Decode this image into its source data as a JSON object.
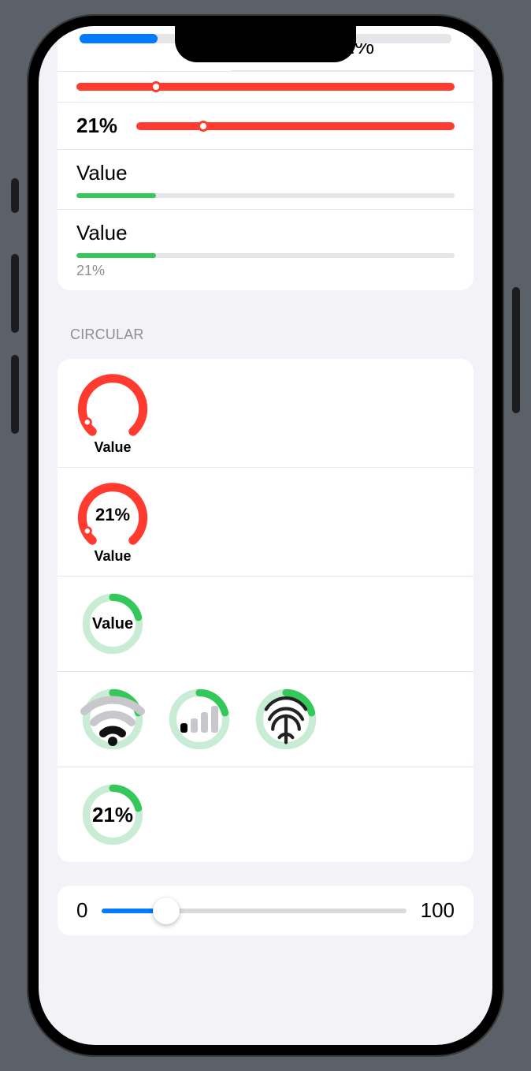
{
  "percent_label": "21%",
  "percent_value": 21,
  "strip_percent": 21,
  "bars": {
    "red_slider_1": {
      "thumb_percent": 21
    },
    "red_slider_2": {
      "label": "21%",
      "thumb_percent": 21
    },
    "value_bar_1": {
      "title": "Value",
      "fill_percent": 21
    },
    "value_bar_2": {
      "title": "Value",
      "fill_percent": 21,
      "caption": "21%"
    }
  },
  "section_circular_header": "CIRCULAR",
  "circular": {
    "gauge_red_1": {
      "percent": 5,
      "label": "Value",
      "color": "#ff3b30"
    },
    "gauge_red_2": {
      "percent": 5,
      "center": "21%",
      "label": "Value",
      "color": "#ff3b30"
    },
    "ring_green_value": {
      "percent": 21,
      "center": "Value",
      "color": "#34c759",
      "track": "#c8ecd4"
    },
    "ring_icons": [
      {
        "name": "wifi",
        "percent": 21
      },
      {
        "name": "cell",
        "percent": 21
      },
      {
        "name": "touchid",
        "percent": 21
      }
    ],
    "ring_green_percent": {
      "percent": 21,
      "center": "21%",
      "color": "#34c759",
      "track": "#c8ecd4"
    }
  },
  "bottom_slider": {
    "min_label": "0",
    "max_label": "100",
    "value_percent": 21
  }
}
